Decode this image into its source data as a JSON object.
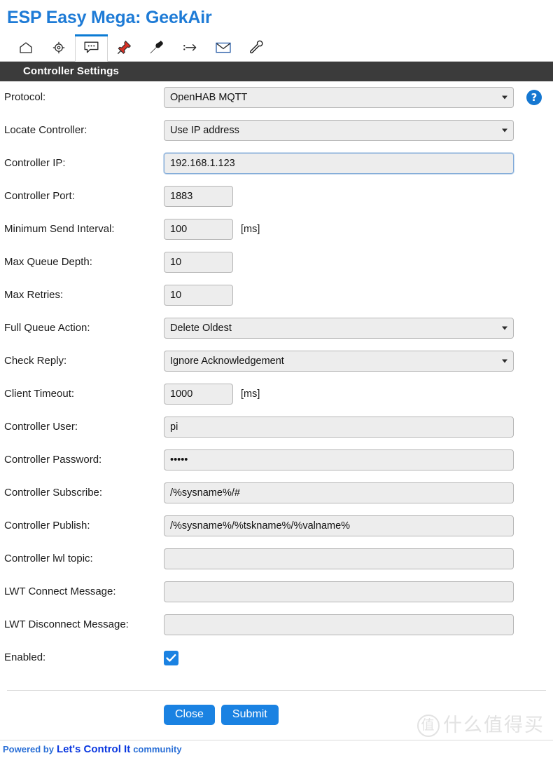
{
  "app": {
    "title": "ESP Easy Mega: GeekAir",
    "accent_color": "#1e7bd6"
  },
  "nav": {
    "items": [
      {
        "icon": "home-icon",
        "name": "nav-home",
        "active": false
      },
      {
        "icon": "gear-icon",
        "name": "nav-config",
        "active": false
      },
      {
        "icon": "chat-icon",
        "name": "nav-controllers",
        "active": true
      },
      {
        "icon": "pin-icon",
        "name": "nav-hardware",
        "active": false
      },
      {
        "icon": "plug-icon",
        "name": "nav-devices",
        "active": false
      },
      {
        "icon": "rules-icon",
        "name": "nav-rules",
        "active": false
      },
      {
        "icon": "mail-icon",
        "name": "nav-notifications",
        "active": false
      },
      {
        "icon": "wrench-icon",
        "name": "nav-tools",
        "active": false
      }
    ]
  },
  "section": {
    "header": "Controller Settings"
  },
  "form": {
    "protocol": {
      "label": "Protocol:",
      "value": "OpenHAB MQTT",
      "options": [
        "OpenHAB MQTT"
      ],
      "help_label": "?"
    },
    "locate_controller": {
      "label": "Locate Controller:",
      "value": "Use IP address",
      "options": [
        "Use IP address"
      ]
    },
    "controller_ip": {
      "label": "Controller IP:",
      "value": "192.168.1.123",
      "focused": true
    },
    "controller_port": {
      "label": "Controller Port:",
      "value": "1883"
    },
    "minimum_send_interval": {
      "label": "Minimum Send Interval:",
      "value": "100",
      "unit": "[ms]"
    },
    "max_queue_depth": {
      "label": "Max Queue Depth:",
      "value": "10"
    },
    "max_retries": {
      "label": "Max Retries:",
      "value": "10"
    },
    "full_queue_action": {
      "label": "Full Queue Action:",
      "value": "Delete Oldest",
      "options": [
        "Delete Oldest"
      ]
    },
    "check_reply": {
      "label": "Check Reply:",
      "value": "Ignore Acknowledgement",
      "options": [
        "Ignore Acknowledgement"
      ]
    },
    "client_timeout": {
      "label": "Client Timeout:",
      "value": "1000",
      "unit": "[ms]"
    },
    "controller_user": {
      "label": "Controller User:",
      "value": "pi"
    },
    "controller_password": {
      "label": "Controller Password:",
      "value": "•••••"
    },
    "controller_subscribe": {
      "label": "Controller Subscribe:",
      "value": "/%sysname%/#"
    },
    "controller_publish": {
      "label": "Controller Publish:",
      "value": "/%sysname%/%tskname%/%valname%"
    },
    "controller_lwl_topic": {
      "label": "Controller lwl topic:",
      "value": ""
    },
    "lwt_connect_message": {
      "label": "LWT Connect Message:",
      "value": ""
    },
    "lwt_disconnect_message": {
      "label": "LWT Disconnect Message:",
      "value": ""
    },
    "enabled": {
      "label": "Enabled:",
      "checked": true
    }
  },
  "actions": {
    "close_label": "Close",
    "submit_label": "Submit"
  },
  "footer": {
    "powered_by": "Powered by",
    "brand": "Let's Control It",
    "suffix": "community"
  },
  "watermark": {
    "mark": "值",
    "text": "什么值得买"
  }
}
